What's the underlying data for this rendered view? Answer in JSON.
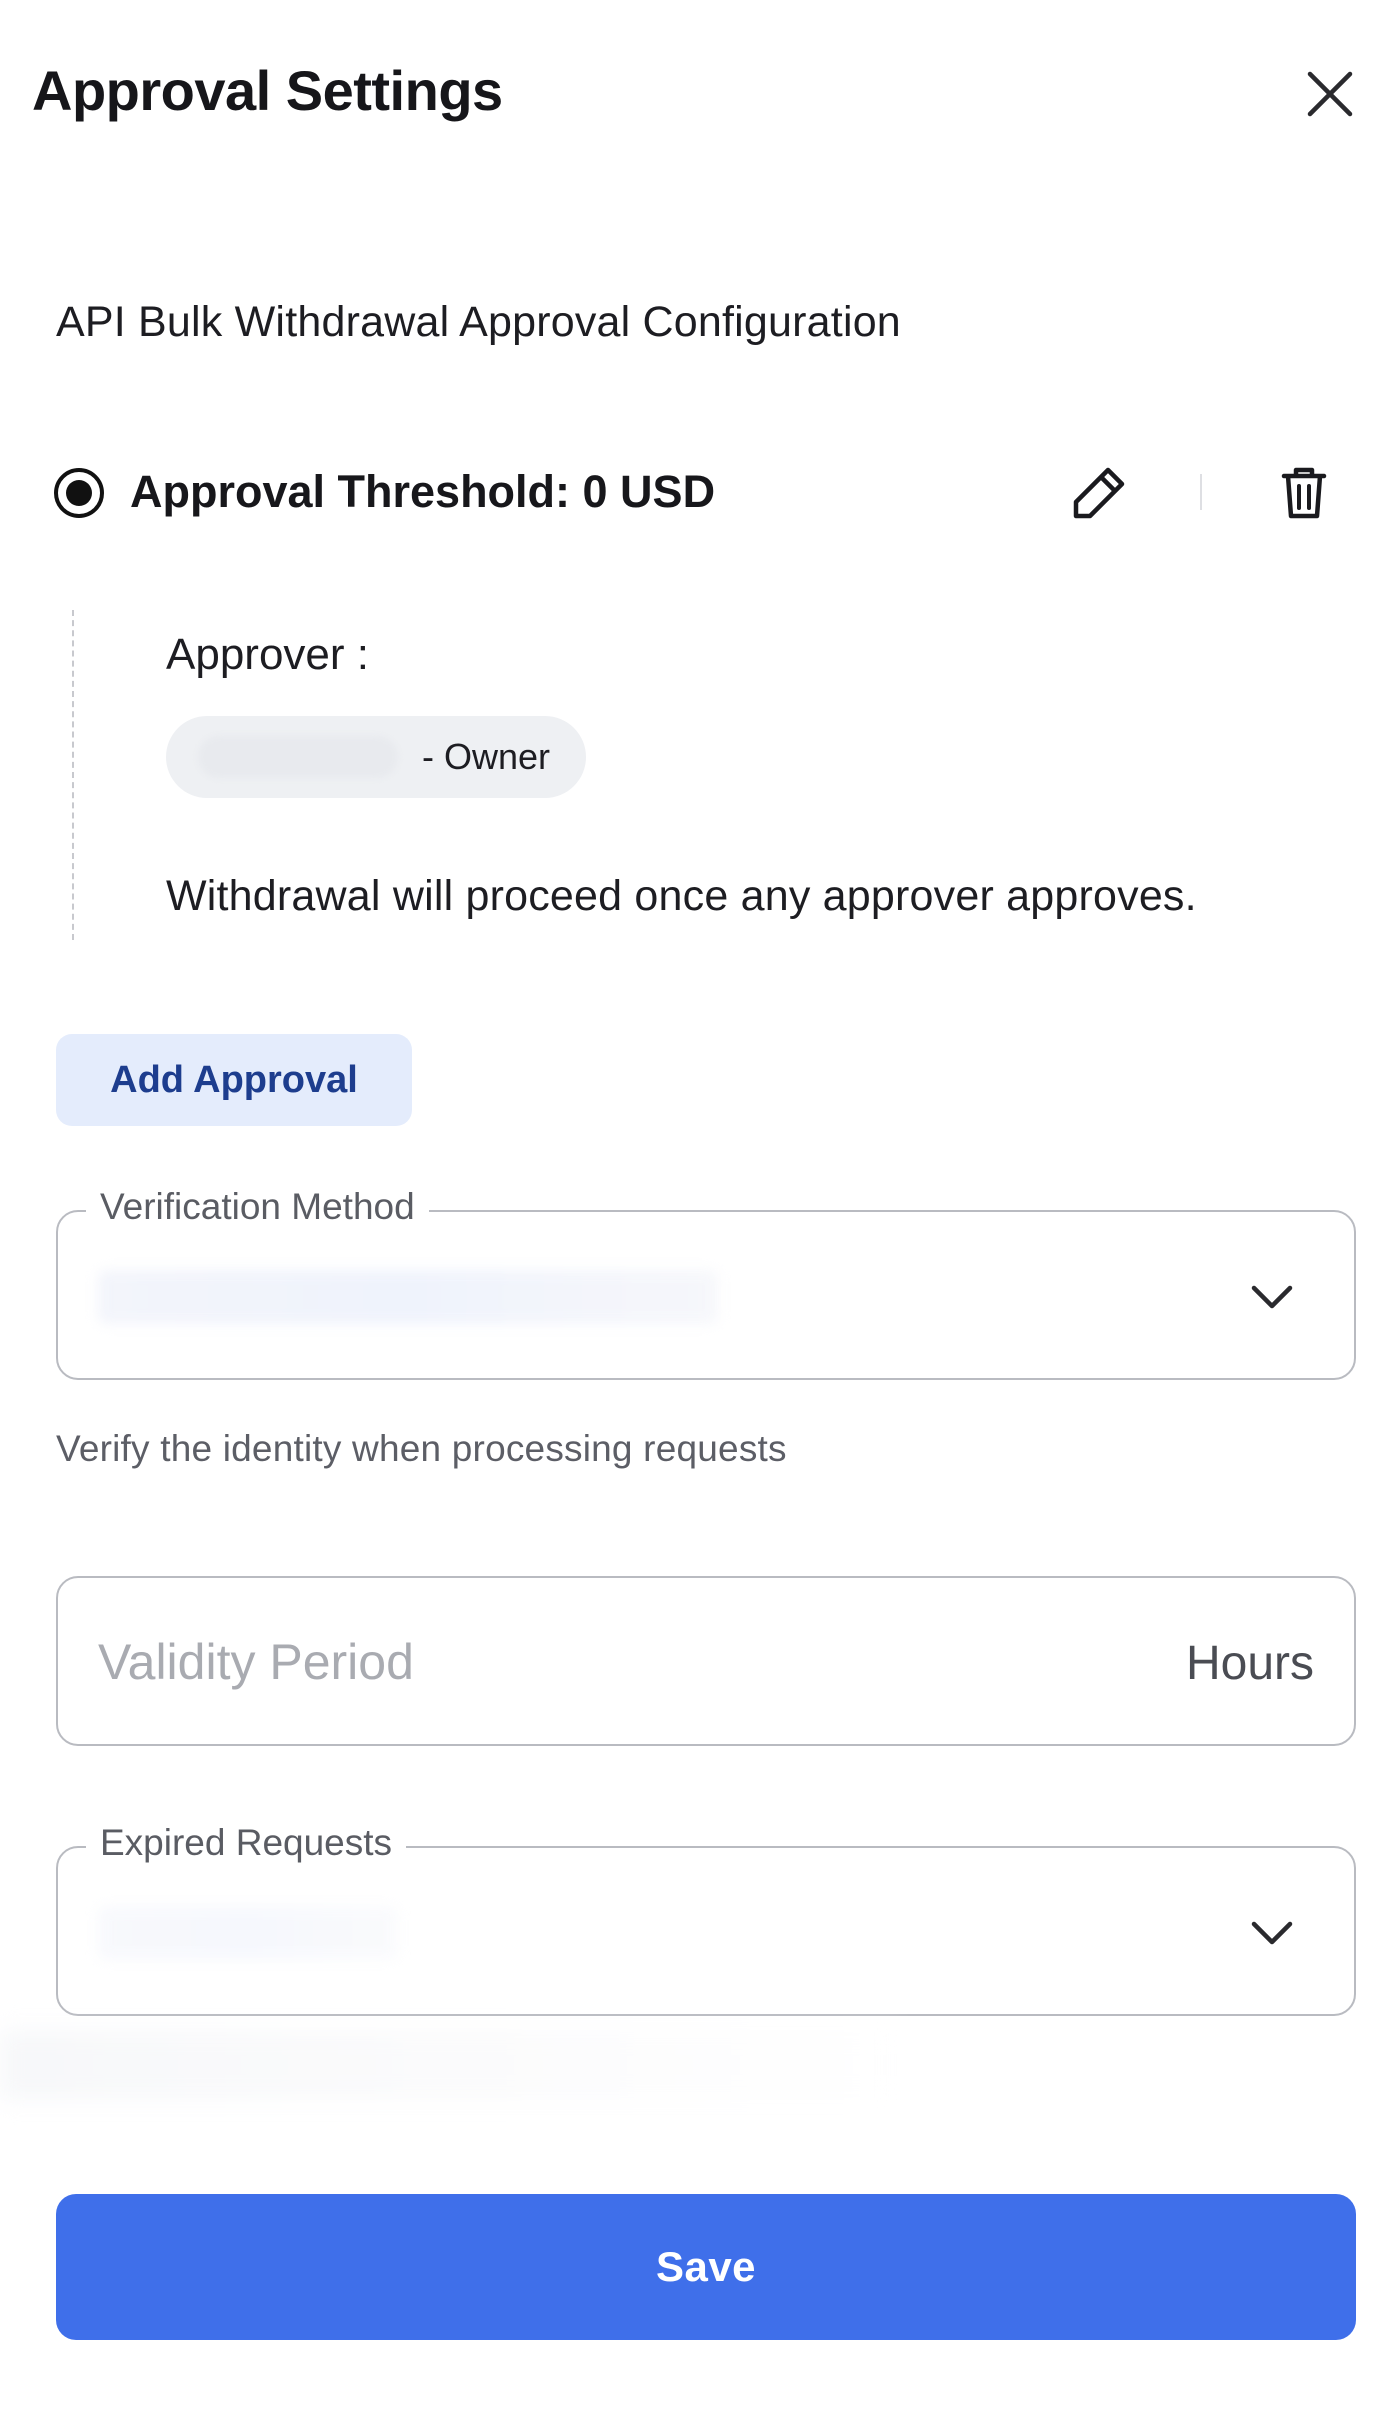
{
  "header": {
    "title": "Approval Settings",
    "close_icon": "close-icon"
  },
  "section": {
    "title": "API Bulk Withdrawal Approval Configuration"
  },
  "threshold": {
    "label": "Approval Threshold: 0 USD",
    "selected": true,
    "edit_icon": "pencil-icon",
    "delete_icon": "trash-icon"
  },
  "approver": {
    "label": "Approver :",
    "role": "- Owner",
    "note": "Withdrawal will proceed once any approver approves."
  },
  "actions": {
    "add_approval": "Add Approval",
    "save": "Save"
  },
  "verification": {
    "legend": "Verification Method",
    "helper": "Verify the identity when processing requests",
    "chevron_icon": "chevron-down-icon"
  },
  "validity": {
    "placeholder": "Validity Period",
    "suffix": "Hours"
  },
  "expired": {
    "legend": "Expired Requests",
    "chevron_icon": "chevron-down-icon"
  },
  "colors": {
    "primary": "#3f6fea",
    "secondary_bg": "#e4ecfc",
    "secondary_text": "#1d3d8e",
    "border": "#b9bbc1"
  }
}
